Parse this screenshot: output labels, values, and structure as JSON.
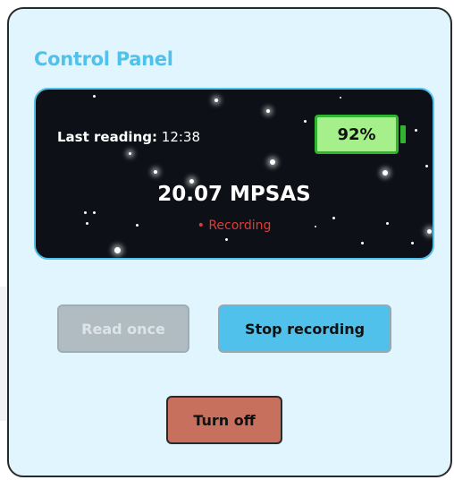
{
  "panel": {
    "title": "Control Panel"
  },
  "display": {
    "last_reading_label": "Last reading:",
    "last_reading_time": "12:38",
    "battery_level": "92%",
    "battery_fraction": 0.92,
    "sky_brightness": "20.07 MPSAS",
    "status": "• Recording",
    "status_color": "#e53935"
  },
  "buttons": {
    "read_once": "Read once",
    "stop_recording": "Stop recording",
    "turn_off": "Turn off"
  },
  "colors": {
    "accent": "#4fc1ea",
    "panel_bg": "#e1f5fe",
    "screen_bg": "#0d1117",
    "battery_fill": "#a6f08c",
    "battery_border": "#2fb52f",
    "turn_off_bg": "#c8705e",
    "disabled_bg": "#b0bcc2"
  }
}
